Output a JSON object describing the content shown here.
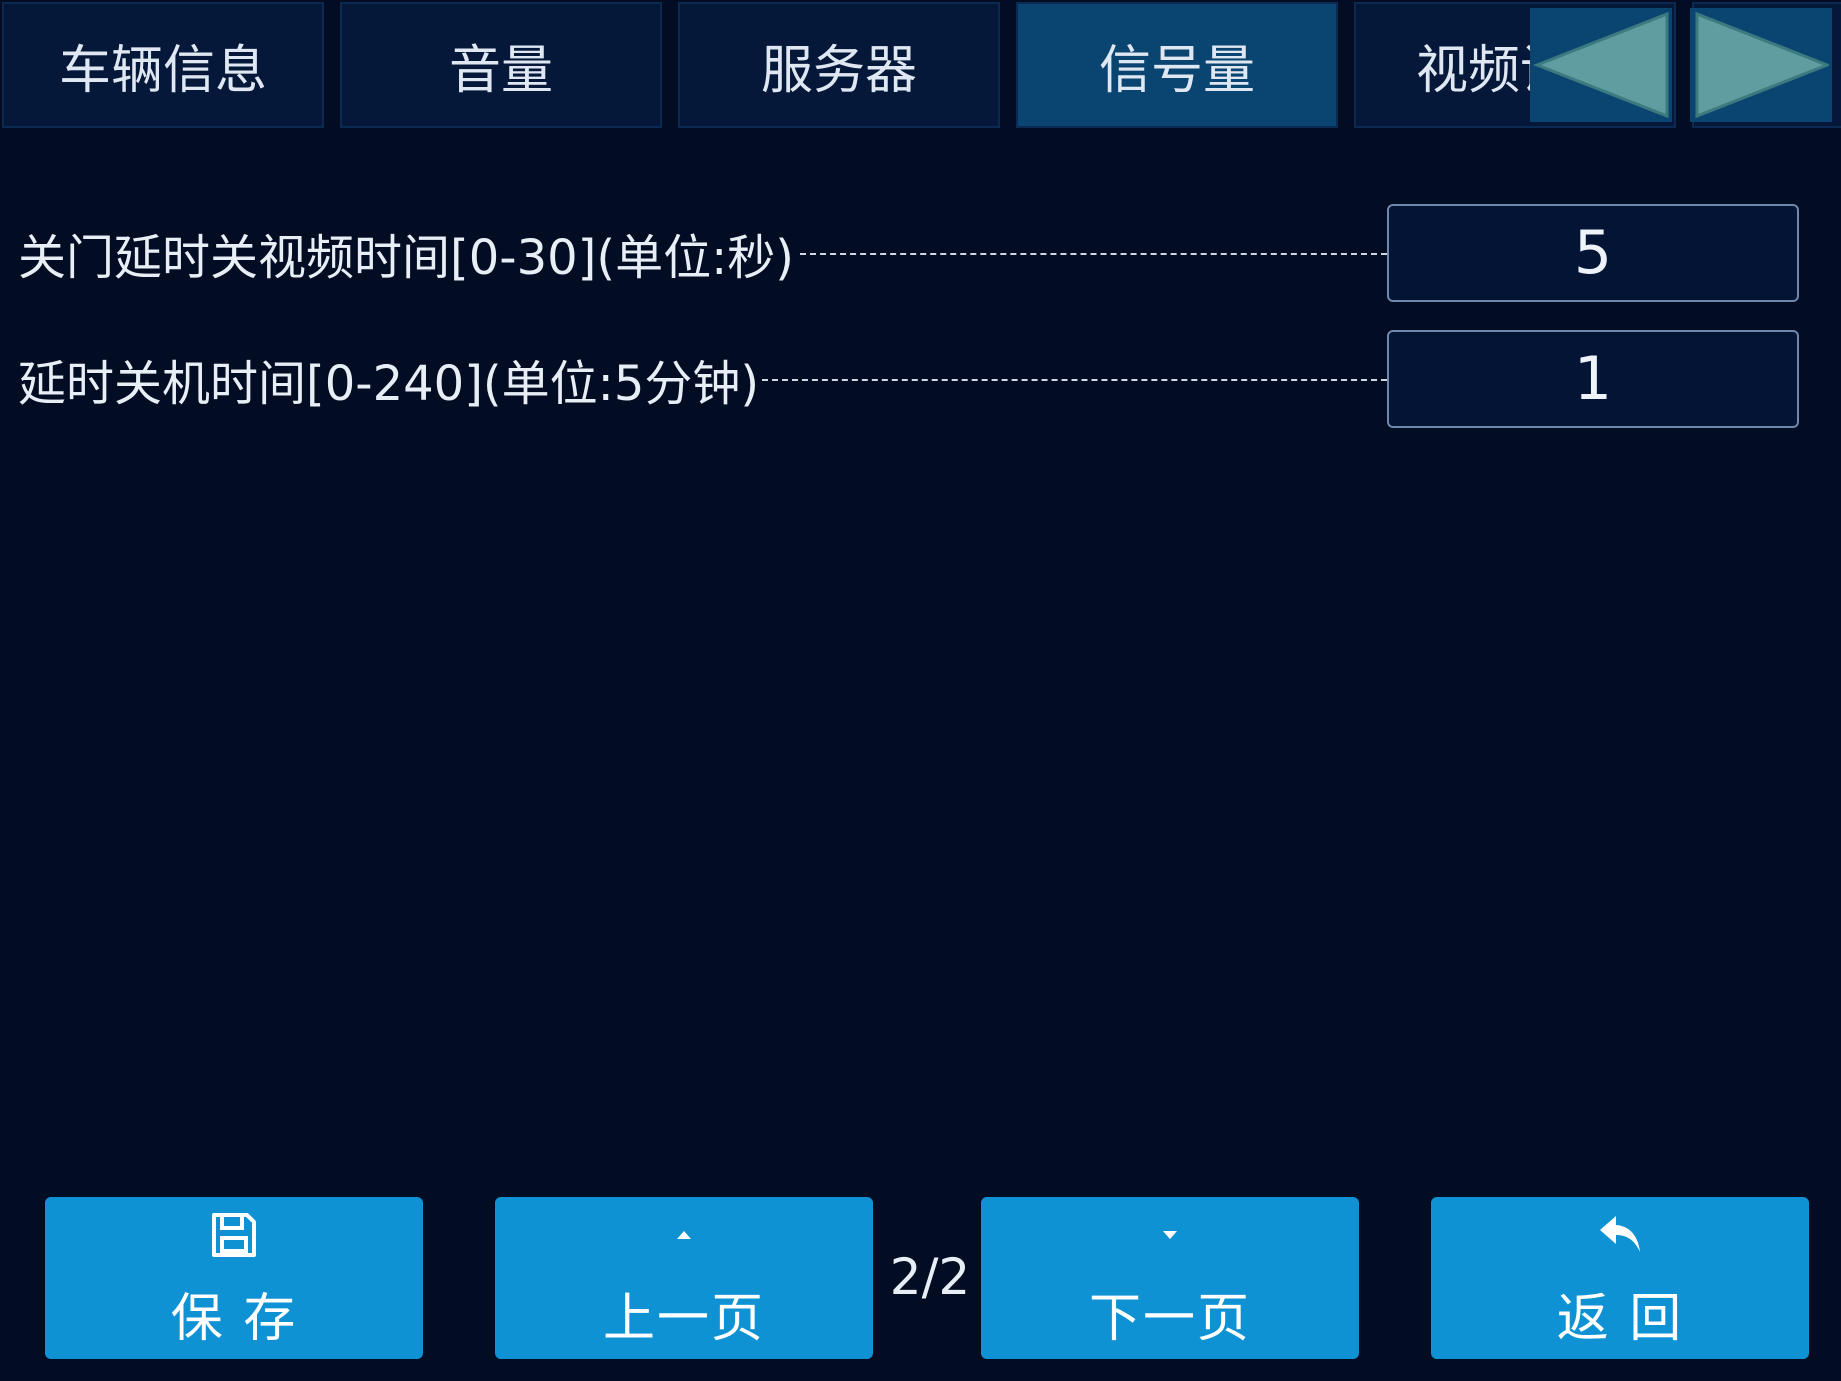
{
  "tabs": [
    {
      "label": "车辆信息"
    },
    {
      "label": "音量"
    },
    {
      "label": "服务器"
    },
    {
      "label": "信号量"
    },
    {
      "label": "视频设"
    }
  ],
  "active_tab": "信号量",
  "tab_nav": {
    "prev_icon": "triangle-left-icon",
    "next_icon": "triangle-right-icon"
  },
  "settings": [
    {
      "label": "关门延时关视频时间[0-30](单位:秒)",
      "value": "5"
    },
    {
      "label": "延时关机时间[0-240](单位:5分钟)",
      "value": "1"
    }
  ],
  "footer": {
    "save_label": "保 存",
    "prev_label": "上一页",
    "next_label": "下一页",
    "back_label": "返 回",
    "page_indicator": "2/2"
  },
  "colors": {
    "background": "#020c22",
    "tab_bg": "#05183a",
    "tab_active_bg": "#0a4470",
    "button_blue": "#0f92d4",
    "arrow_fill": "#5e9ea0"
  }
}
